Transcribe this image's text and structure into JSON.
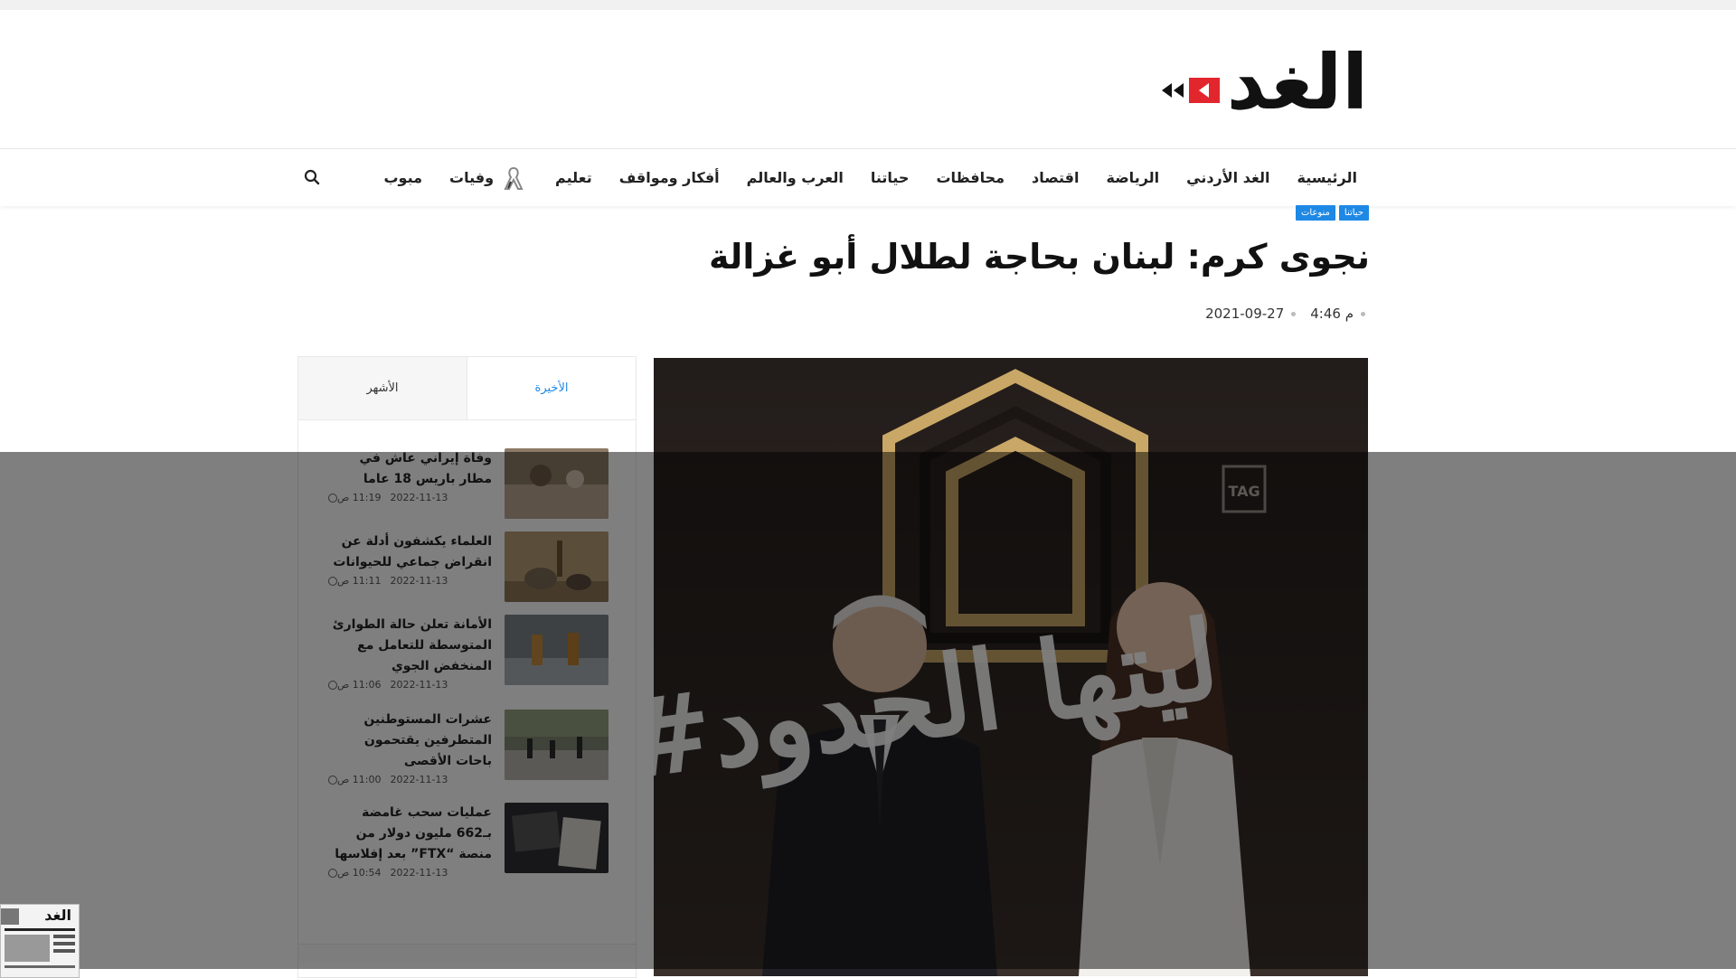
{
  "brand": {
    "logo_text": "الغد",
    "accent_color": "#e1262d"
  },
  "nav": {
    "items": [
      "الرئيسية",
      "الغد الأردني",
      "الرياضة",
      "اقتصاد",
      "محافظات",
      "حياتنا",
      "العرب والعالم",
      "أفكار ومواقف",
      "تعليم",
      "وفيات",
      "مبوب"
    ],
    "search_icon": "search-icon",
    "ribbon_icon": "ribbon-icon"
  },
  "article": {
    "tags": [
      "حياتنا",
      "منوعات"
    ],
    "title": "نجوى كرم: لبنان بحاجة لطلال أبو غزالة",
    "time": "4:46 م",
    "date": "2021-09-27",
    "hero_overlay_text": "#ليتها الحدود",
    "hero_logo": "TAG"
  },
  "sidebar": {
    "tabs": [
      "الأخيرة",
      "الأشهر"
    ],
    "active_tab": "الأخيرة",
    "posts": [
      {
        "title": "وفاة إيراني عاش في مطار باريس 18 عاما",
        "time": "11:19 ص",
        "date": "2022-11-13"
      },
      {
        "title": "العلماء يكشفون أدلة عن انقراض جماعي للحيوانات",
        "time": "11:11 ص",
        "date": "2022-11-13"
      },
      {
        "title": "الأمانة تعلن حالة الطوارئ المتوسطة للتعامل مع المنخفض الجوي",
        "time": "11:06 ص",
        "date": "2022-11-13"
      },
      {
        "title": "عشرات المستوطنين المتطرفين يقتحمون باحات الأقصى",
        "time": "11:00 ص",
        "date": "2022-11-13"
      },
      {
        "title": "عمليات سحب غامضة بـ662 مليون دولار من منصة “FTX” بعد إفلاسها",
        "time": "10:54 ص",
        "date": "2022-11-13"
      }
    ]
  },
  "mini_paper": {
    "title": "الغد"
  }
}
